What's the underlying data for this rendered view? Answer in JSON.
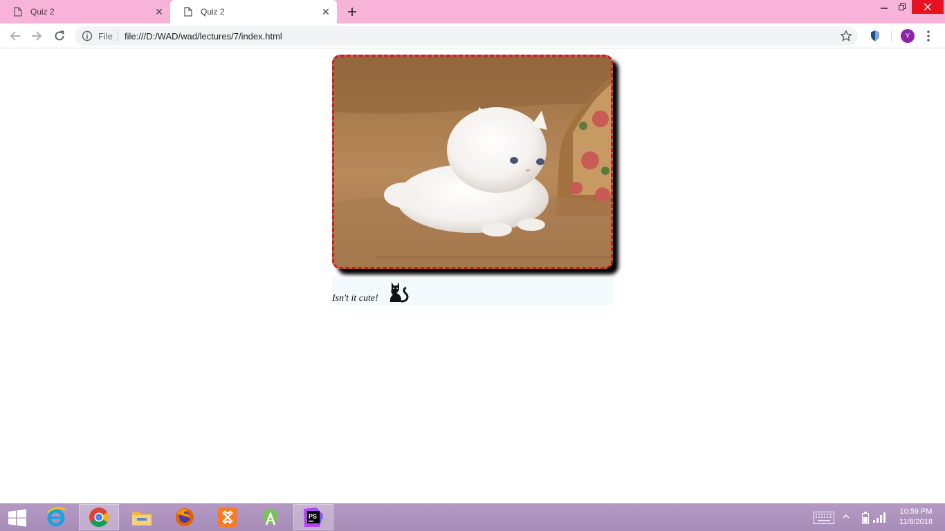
{
  "browser": {
    "tabs": [
      {
        "title": "Quiz 2",
        "active": false
      },
      {
        "title": "Quiz 2",
        "active": true
      }
    ],
    "new_tab_icon": "plus-icon",
    "window_controls": [
      "minimize-icon",
      "restore-icon",
      "close-icon"
    ],
    "tabstrip_color": "#f8b3d8",
    "close_button_color": "#e81123"
  },
  "toolbar": {
    "nav_icons": [
      "back-arrow-icon",
      "forward-arrow-icon",
      "reload-icon"
    ],
    "address": {
      "scheme_label": "File",
      "url": "file:///D:/WAD/wad/lectures/7/index.html"
    },
    "bookmark_icon": "star-icon",
    "extension_icon": "shield-extension-icon",
    "profile_initial": "Y",
    "profile_color": "#8e24aa",
    "menu_icon": "kebab-menu-icon"
  },
  "page": {
    "image_subject": "white-kitten-photo",
    "frame_border_color": "#d11a1a",
    "caption_text": "Isn't it cute!",
    "caption_icon": "black-cat-icon",
    "caption_background": "#f3fafd"
  },
  "taskbar": {
    "apps": [
      {
        "name": "internet-explorer-icon",
        "active": false
      },
      {
        "name": "chrome-icon",
        "active": true
      },
      {
        "name": "file-explorer-icon",
        "active": false
      },
      {
        "name": "firefox-icon",
        "active": false
      },
      {
        "name": "xampp-icon",
        "active": false
      },
      {
        "name": "android-studio-icon",
        "active": false
      },
      {
        "name": "phpstorm-icon",
        "active": false
      }
    ],
    "phpstorm_label": "PS",
    "clock_time": "10:59 PM",
    "clock_date": "11/8/2018"
  }
}
